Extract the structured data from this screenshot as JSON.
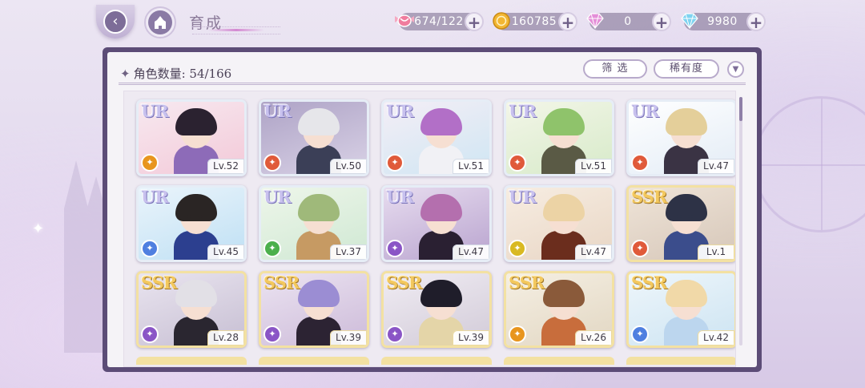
{
  "topbar": {
    "back_icon": "back-arrow-icon",
    "home_icon": "castle-home-icon",
    "title": "育成"
  },
  "currencies": [
    {
      "name": "candy",
      "icon": "candy-icon",
      "value": "674/122",
      "color": "#f08aa8"
    },
    {
      "name": "coin",
      "icon": "gold-coin-icon",
      "value": "160785",
      "color": "#f2b632"
    },
    {
      "name": "gem",
      "icon": "pink-gem-icon",
      "value": "0",
      "color": "#e48fd8"
    },
    {
      "name": "diamond",
      "icon": "diamond-icon",
      "value": "9980",
      "color": "#7fd3f0"
    }
  ],
  "panel": {
    "count_label": "角色数量: 54/166",
    "filter_label": "筛 选",
    "rarity_label": "稀有度",
    "sort_icon": "sort-direction-icon"
  },
  "characters": [
    {
      "rarity": "UR",
      "level": "Lv.52",
      "attr_color": "#e8951e",
      "bg": [
        "#f3c9d8",
        "#f7e9f0"
      ],
      "hair": "#2b2230",
      "outfit": "#8d6bb8"
    },
    {
      "rarity": "UR",
      "level": "Lv.50",
      "attr_color": "#e05a3a",
      "bg": [
        "#d9d2e6",
        "#aea3c6"
      ],
      "hair": "#e6e6ea",
      "outfit": "#3b3f57"
    },
    {
      "rarity": "UR",
      "level": "Lv.51",
      "attr_color": "#e05a3a",
      "bg": [
        "#cfe6f3",
        "#f4eef6"
      ],
      "hair": "#b26fc7",
      "outfit": "#f1f1f5"
    },
    {
      "rarity": "UR",
      "level": "Lv.51",
      "attr_color": "#e05a3a",
      "bg": [
        "#d7eac9",
        "#f3f6e8"
      ],
      "hair": "#8fc36b",
      "outfit": "#5a5a45"
    },
    {
      "rarity": "UR",
      "level": "Lv.47",
      "attr_color": "#e05a3a",
      "bg": [
        "#e3ecf6",
        "#ffffff"
      ],
      "hair": "#e4cf9a",
      "outfit": "#3a3344"
    },
    {
      "rarity": "UR",
      "level": "Lv.45",
      "attr_color": "#4f7fe0",
      "bg": [
        "#bfe0f4",
        "#eaf4fb"
      ],
      "hair": "#2a2524",
      "outfit": "#2c3f8f"
    },
    {
      "rarity": "UR",
      "level": "Lv.37",
      "attr_color": "#4bb04c",
      "bg": [
        "#cfe8d3",
        "#eef6ea"
      ],
      "hair": "#9fb97a",
      "outfit": "#c69a63"
    },
    {
      "rarity": "UR",
      "level": "Lv.47",
      "attr_color": "#8a55c6",
      "bg": [
        "#b9a4cf",
        "#e7dcef"
      ],
      "hair": "#b46fae",
      "outfit": "#2a2032"
    },
    {
      "rarity": "UR",
      "level": "Lv.47",
      "attr_color": "#d9b922",
      "bg": [
        "#e8d6c5",
        "#f7ede2"
      ],
      "hair": "#ecd3a5",
      "outfit": "#6b2d1d"
    },
    {
      "rarity": "SSR",
      "level": "Lv.1",
      "attr_color": "#e05a3a",
      "bg": [
        "#d6c7b9",
        "#efe4d8"
      ],
      "hair": "#2d3246",
      "outfit": "#3b4d8c"
    },
    {
      "rarity": "SSR",
      "level": "Lv.28",
      "attr_color": "#8a55c6",
      "bg": [
        "#c7bfd3",
        "#e9e4ef"
      ],
      "hair": "#e2e0e6",
      "outfit": "#2a2630"
    },
    {
      "rarity": "SSR",
      "level": "Lv.39",
      "attr_color": "#8a55c6",
      "bg": [
        "#cdbbd9",
        "#ebe3f1"
      ],
      "hair": "#9b8dd3",
      "outfit": "#2c2333"
    },
    {
      "rarity": "SSR",
      "level": "Lv.39",
      "attr_color": "#8a55c6",
      "bg": [
        "#d2cbd8",
        "#f0ecf3"
      ],
      "hair": "#1f1d2a",
      "outfit": "#e4d5a8"
    },
    {
      "rarity": "SSR",
      "level": "Lv.26",
      "attr_color": "#e8951e",
      "bg": [
        "#e2d7c3",
        "#f5efe3"
      ],
      "hair": "#8a5a3a",
      "outfit": "#c86d3c"
    },
    {
      "rarity": "SSR",
      "level": "Lv.42",
      "attr_color": "#4f7fe0",
      "bg": [
        "#cde4f2",
        "#eef6fb"
      ],
      "hair": "#f1d9a8",
      "outfit": "#bcd6ee"
    }
  ]
}
